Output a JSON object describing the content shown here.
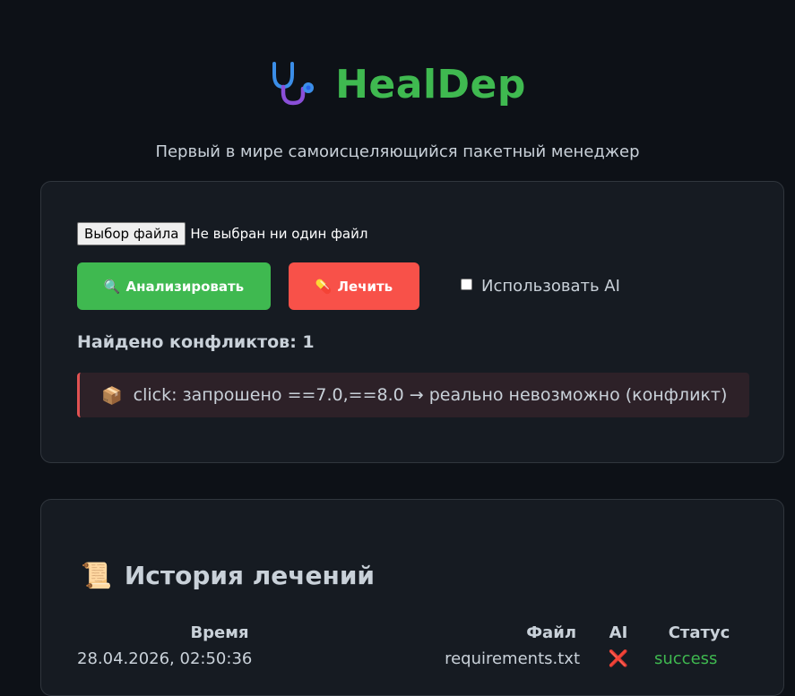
{
  "app": {
    "title": "HealDep",
    "subtitle": "Первый в мире самоисцеляющийся пакетный менеджер",
    "logo_icon": "stethoscope-icon",
    "accent_color": "#3fb950"
  },
  "upload": {
    "file_button_label": "Выбор файла",
    "file_status": "Не выбран ни один файл"
  },
  "actions": {
    "analyze_icon": "🔍",
    "analyze_label": "Анализировать",
    "analyze_color": "#3fb950",
    "heal_icon": "💊",
    "heal_label": "Лечить",
    "heal_color": "#f85149",
    "use_ai_label": "Использовать AI",
    "use_ai_checked": false
  },
  "conflicts": {
    "heading": "Найдено конфликтов: 1",
    "items": [
      {
        "icon": "📦",
        "text": "click: запрошено ==7.0,==8.0 → реально невозможно (конфликт)"
      }
    ]
  },
  "history": {
    "icon": "📜",
    "title": "История лечений",
    "columns": [
      "Время",
      "Файл",
      "AI",
      "Статус"
    ],
    "rows": [
      {
        "time": "28.04.2026, 02:50:36",
        "file": "requirements.txt",
        "ai": "❌",
        "status": "success"
      }
    ]
  }
}
